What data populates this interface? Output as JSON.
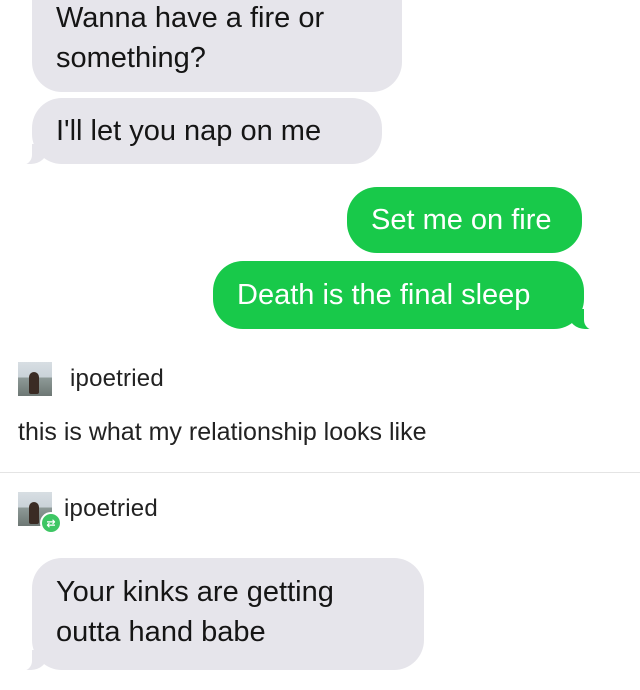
{
  "conversation_top": {
    "messages": [
      {
        "direction": "received",
        "lines": [
          "Wanna have a fire or",
          "something?"
        ]
      },
      {
        "direction": "received",
        "lines": [
          "I'll let you nap on me"
        ]
      },
      {
        "direction": "sent",
        "lines": [
          "Set me on fire"
        ]
      },
      {
        "direction": "sent",
        "lines": [
          "Death is the final sleep"
        ]
      }
    ]
  },
  "post1": {
    "username": "ipoetried",
    "comment": "this is what my relationship looks like"
  },
  "post2": {
    "username": "ipoetried",
    "reblog_icon": "retweet-icon",
    "message": {
      "direction": "received",
      "lines": [
        "Your kinks are getting",
        "outta hand babe"
      ]
    }
  },
  "colors": {
    "received_bubble": "#e6e5eb",
    "sent_bubble": "#18c94a",
    "reblog_badge": "#3ec664"
  }
}
